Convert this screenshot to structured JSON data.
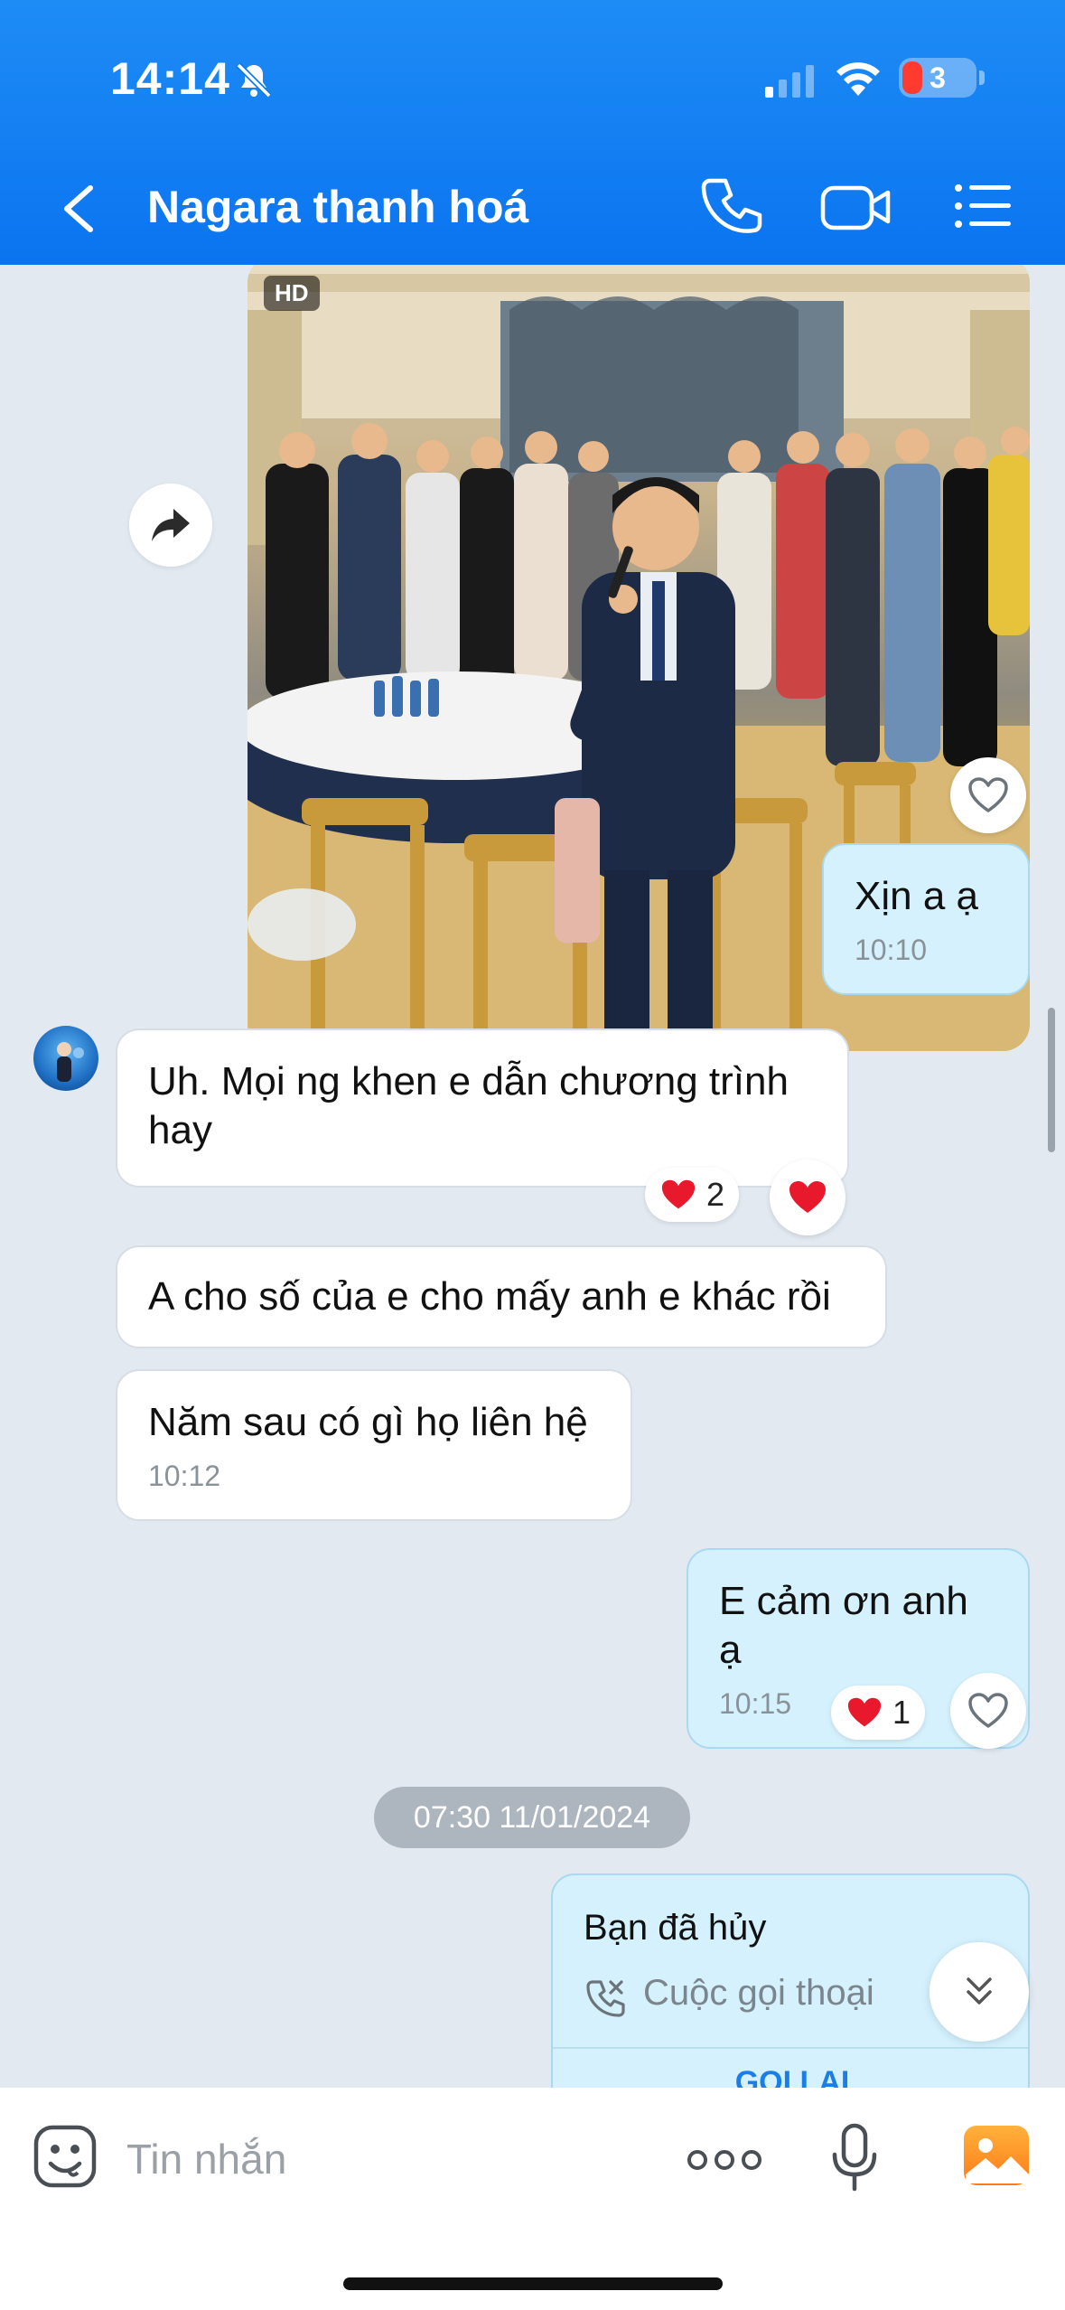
{
  "status_bar": {
    "time": "14:14",
    "battery": "3"
  },
  "header": {
    "title": "Nagara thanh hoá",
    "icons": [
      "back-chevron-icon",
      "phone-icon",
      "video-camera-icon",
      "list-menu-icon"
    ]
  },
  "photo_message": {
    "badge": "HD",
    "liked": false
  },
  "messages": [
    {
      "direction": "out",
      "text": "Xịn a ạ",
      "time": "10:10"
    },
    {
      "direction": "in",
      "text": "Uh. Mọi ng khen e dẫn chương trình hay",
      "reaction_count": "2"
    },
    {
      "direction": "in",
      "text": "A cho số của e cho mấy anh e khác rồi"
    },
    {
      "direction": "in",
      "text": "Năm sau có gì họ liên hệ",
      "time": "10:12"
    },
    {
      "direction": "out",
      "text": "E cảm ơn anh ạ",
      "time": "10:15",
      "reaction_count": "1"
    }
  ],
  "date_separator": "07:30 11/01/2024",
  "call_card": {
    "status": "Bạn đã hủy",
    "type": "Cuộc gọi thoại",
    "action": "GỌI LẠI"
  },
  "input": {
    "placeholder": "Tin nhắn"
  },
  "colors": {
    "header": "#0a74f0",
    "outgoing_bubble": "#d4f1fd",
    "chat_background": "#e2e9f1",
    "reaction_heart": "#e8192c"
  }
}
